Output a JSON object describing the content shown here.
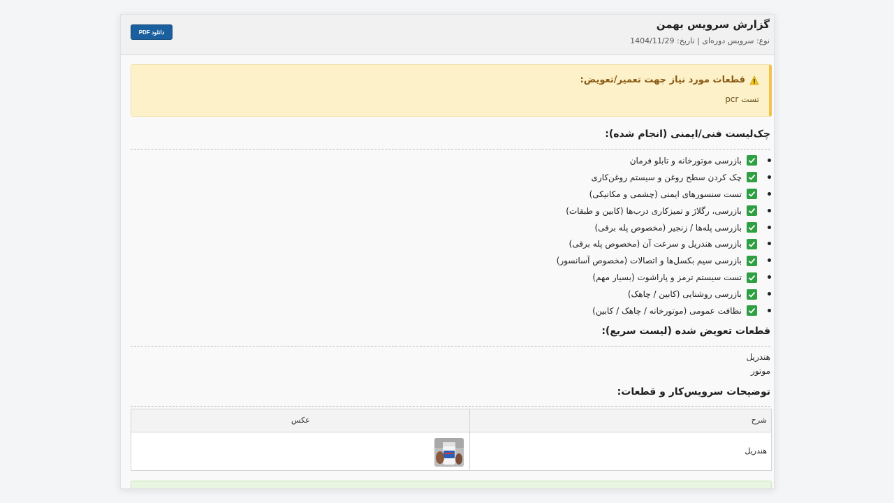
{
  "header": {
    "title": "گزارش سرویس بهمن",
    "subtitle": "نوع: سرویس دوره‌ای | تاریخ: 1404/11/29",
    "pdf_button": "دانلود PDF"
  },
  "alert": {
    "title": "قطعات مورد نیاز جهت تعمیر/تعویض:",
    "body": "تست pcr",
    "icon": "warning-icon"
  },
  "checklist": {
    "title": "چک‌لیست فنی/ایمنی (انجام شده):",
    "items": [
      "بازرسی موتورخانه و تابلو فرمان",
      "چک کردن سطح روغن و سیستم روغن‌کاری",
      "تست سنسورهای ایمنی (چشمی و مکانیکی)",
      "بازرسی، رگلاژ و تمیزکاری درب‌ها (کابین و طبقات)",
      "بازرسی پله‌ها / زنجیر (مخصوص پله برقی)",
      "بازرسی هندریل و سرعت آن (مخصوص پله برقی)",
      "بازرسی سیم بکسل‌ها و اتصالات (مخصوص آسانسور)",
      "تست سیستم ترمز و پاراشوت (بسیار مهم)",
      "بازرسی روشنایی (کابین / چاهک)",
      "نظافت عمومی (موتورخانه / چاهک / کابین)"
    ]
  },
  "replaced": {
    "title": "قطعات تعویض شده (لیست سریع):",
    "items": [
      "هندریل",
      "موتور"
    ]
  },
  "notes": {
    "title": "توضیحات سرویس‌کار و قطعات:",
    "col_desc": "شرح",
    "col_photo": "عکس",
    "rows": [
      {
        "desc": "هندریل"
      }
    ]
  },
  "colors": {
    "accent": "#1a5f9e",
    "warning_bg": "#fdf1c9",
    "check_green": "#2ea043"
  }
}
